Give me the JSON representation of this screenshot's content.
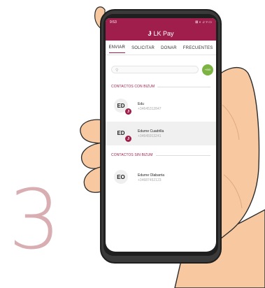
{
  "step": {
    "number": "3"
  },
  "status_bar": {
    "time": "9:53",
    "indicators": "⊠ ◐ ♫ ▿ ▭"
  },
  "app": {
    "logo_icon": "bizum-logo-icon",
    "logo_glyph": "Ɉ",
    "title": "LK Pay"
  },
  "tabs": [
    {
      "label": "ENVIAR",
      "active": true
    },
    {
      "label": "SOLICITAR",
      "active": false
    },
    {
      "label": "DONAR",
      "active": false
    },
    {
      "label": "FRECUENTES",
      "active": false
    }
  ],
  "search": {
    "icon": "search-icon",
    "glyph": "⚲",
    "placeholder": ""
  },
  "add_button": {
    "label": "+ΘΘ"
  },
  "sections": {
    "with_bizum": "CONTACTOS CON BIZUM",
    "without_bizum": "CONTACTOS SIN BIZUM"
  },
  "contacts_with_bizum": [
    {
      "initials": "ED",
      "name": "Edu",
      "phone": "+34645312847",
      "badge": "Ɉ",
      "selected": false
    },
    {
      "initials": "ED",
      "name": "Edurne Cuadrilla",
      "phone": "+34645913241",
      "badge": "Ɉ",
      "selected": true
    }
  ],
  "contacts_without_bizum": [
    {
      "initials": "EO",
      "name": "Edurne Olabarria",
      "phone": "+34687452123"
    }
  ],
  "colors": {
    "brand": "#a01e4b",
    "accent_green": "#7cb342",
    "skin": "#f8c9a0",
    "outline": "#2b2b2b",
    "step_number": "#d9aeb3"
  }
}
